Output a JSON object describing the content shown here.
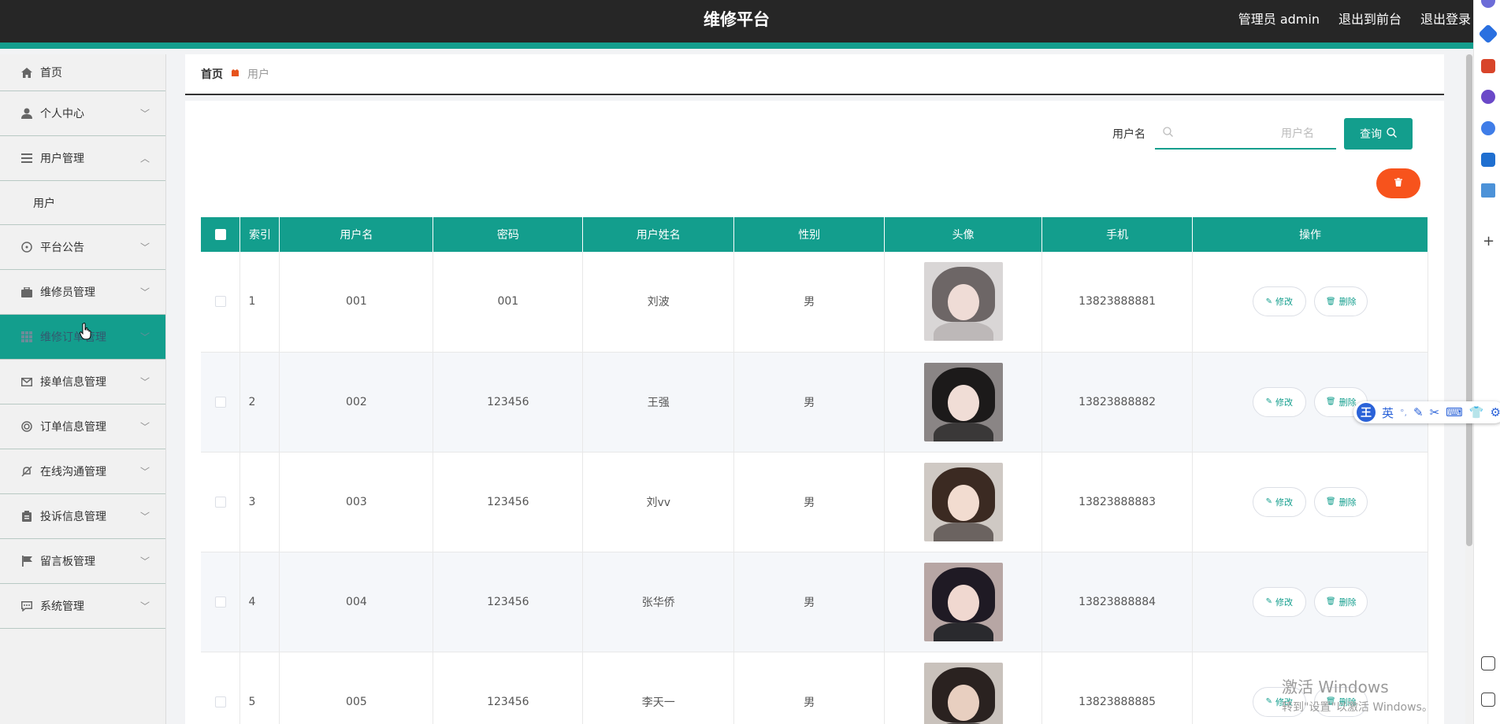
{
  "header": {
    "title": "维修平台",
    "admin_label": "管理员 admin",
    "front_link": "退出到前台",
    "logout_link": "退出登录"
  },
  "sidebar": {
    "items": [
      {
        "label": "首页",
        "icon": "home-icon"
      },
      {
        "label": "个人中心",
        "icon": "user-icon"
      },
      {
        "label": "用户管理",
        "icon": "menu-icon",
        "expanded": true
      },
      {
        "label": "用户",
        "sub": true
      },
      {
        "label": "平台公告",
        "icon": "compass-icon"
      },
      {
        "label": "维修员管理",
        "icon": "briefcase-icon"
      },
      {
        "label": "维修订单管理",
        "icon": "grid-icon",
        "active": true
      },
      {
        "label": "接单信息管理",
        "icon": "mail-icon"
      },
      {
        "label": "订单信息管理",
        "icon": "target-icon"
      },
      {
        "label": "在线沟通管理",
        "icon": "bell-off-icon"
      },
      {
        "label": "投诉信息管理",
        "icon": "clipboard-icon"
      },
      {
        "label": "留言板管理",
        "icon": "flag-icon"
      },
      {
        "label": "系统管理",
        "icon": "chat-icon"
      }
    ]
  },
  "breadcrumb": {
    "home": "首页",
    "current": "用户"
  },
  "search": {
    "label": "用户名",
    "placeholder": "用户名",
    "button": "查询"
  },
  "toolbar": {
    "delete_icon": "trash-icon"
  },
  "table": {
    "headers": [
      "索引",
      "用户名",
      "密码",
      "用户姓名",
      "性别",
      "头像",
      "手机",
      "操作"
    ],
    "rows": [
      {
        "index": "1",
        "username": "001",
        "password": "001",
        "name": "刘波",
        "gender": "男",
        "phone": "13823888881"
      },
      {
        "index": "2",
        "username": "002",
        "password": "123456",
        "name": "王强",
        "gender": "男",
        "phone": "13823888882"
      },
      {
        "index": "3",
        "username": "003",
        "password": "123456",
        "name": "刘vv",
        "gender": "男",
        "phone": "13823888883"
      },
      {
        "index": "4",
        "username": "004",
        "password": "123456",
        "name": "张华侨",
        "gender": "男",
        "phone": "13823888884"
      },
      {
        "index": "5",
        "username": "005",
        "password": "123456",
        "name": "李天一",
        "gender": "男",
        "phone": "13823888885"
      }
    ],
    "edit_label": "修改",
    "delete_label": "删除"
  },
  "ime": {
    "logo": "王",
    "lang": "英",
    "punct": "°,"
  },
  "watermark": {
    "line1": "激活 Windows",
    "line2": "转到\"设置\"以激活 Windows。"
  }
}
